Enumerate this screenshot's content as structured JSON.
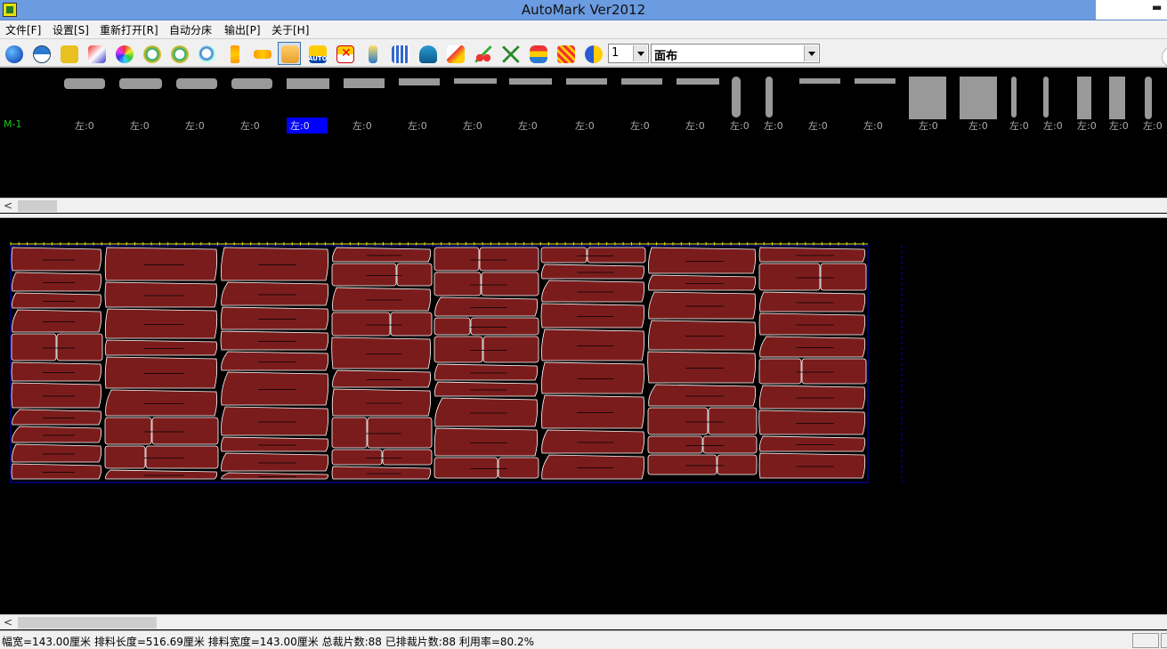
{
  "app": {
    "title": "AutoMark Ver2012"
  },
  "menu": [
    "文件[F]",
    "设置[S]",
    "重新打开[R]",
    "自动分床",
    "输出[P]",
    "关于[H]"
  ],
  "toolbar": {
    "icons": [
      "globe-icon",
      "half-globe-icon",
      "arrow-rotate-icon",
      "paint-icon",
      "color-wheel-icon",
      "rotate-left-icon",
      "rotate-right-icon",
      "zoom-icon",
      "move-vertical-icon",
      "move-horizontal-icon",
      "hand-select-icon",
      "auto-icon",
      "cancel-icon",
      "arrow-up-icon",
      "piece-icon",
      "database-icon",
      "edit-icon",
      "scissors-icon",
      "compass-icon",
      "layer-icon",
      "pattern-icon",
      "yinyang-icon"
    ],
    "auto_label": "AUTO",
    "layer_select": "1",
    "fabric_select": "面布"
  },
  "pieces": {
    "marker_label": "M-1",
    "items": [
      "左:0",
      "左:0",
      "左:0",
      "左:0",
      "左:0",
      "左:0",
      "左:0",
      "左:0",
      "左:0",
      "左:0",
      "左:0",
      "左:0",
      "左:0",
      "左:0",
      "左:0",
      "左:0",
      "左:0",
      "左:0",
      "左:0",
      "左:0",
      "左:0",
      "左:0",
      "左:0"
    ],
    "selected_index": 4
  },
  "colors": {
    "fabric": "#7b1c1c",
    "marker_border": "#0000cc",
    "ruler": "#e6e600"
  },
  "status": {
    "text": "幅宽=143.00厘米 排料长度=516.69厘米 排料宽度=143.00厘米 总裁片数:88 已排裁片数:88 利用率=80.2%"
  }
}
